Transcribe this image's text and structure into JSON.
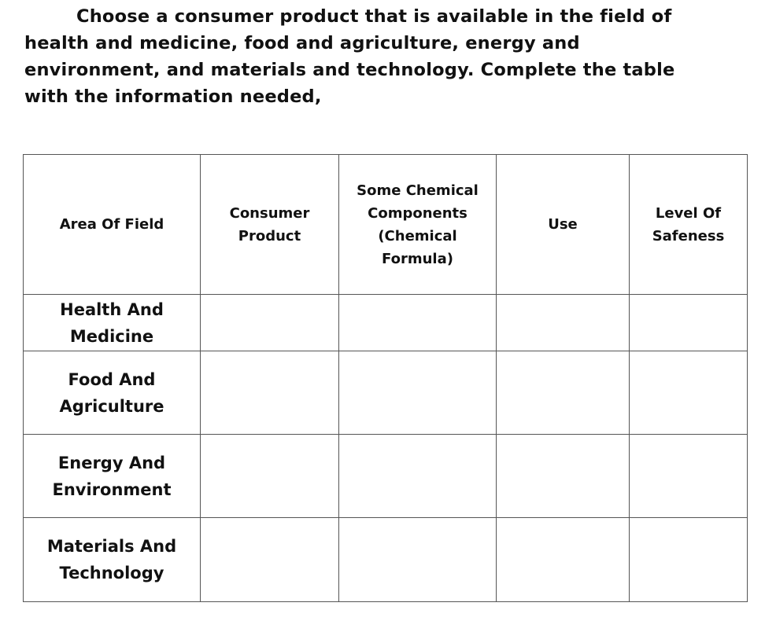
{
  "instructions": {
    "lines": [
      "Choose a consumer product that is available in the field of",
      "health and medicine, food and agriculture, energy and",
      "environment, and materials and technology. Complete the table",
      "with the information needed,"
    ]
  },
  "table": {
    "headers": [
      {
        "lines": [
          "Area Of Field"
        ]
      },
      {
        "lines": [
          "Consumer",
          "Product"
        ]
      },
      {
        "lines": [
          "Some Chemical",
          "Components",
          "(Chemical",
          "Formula)"
        ]
      },
      {
        "lines": [
          "Use"
        ]
      },
      {
        "lines": [
          "Level Of",
          "Safeness"
        ]
      }
    ],
    "rows": [
      {
        "field": [
          "Health And",
          "Medicine"
        ],
        "consumer_product": "",
        "chemical_components": "",
        "use": "",
        "safeness": ""
      },
      {
        "field": [
          "Food And",
          "Agriculture"
        ],
        "consumer_product": "",
        "chemical_components": "",
        "use": "",
        "safeness": ""
      },
      {
        "field": [
          "Energy And",
          "Environment"
        ],
        "consumer_product": "",
        "chemical_components": "",
        "use": "",
        "safeness": ""
      },
      {
        "field": [
          "Materials And",
          "Technology"
        ],
        "consumer_product": "",
        "chemical_components": "",
        "use": "",
        "safeness": ""
      }
    ]
  }
}
